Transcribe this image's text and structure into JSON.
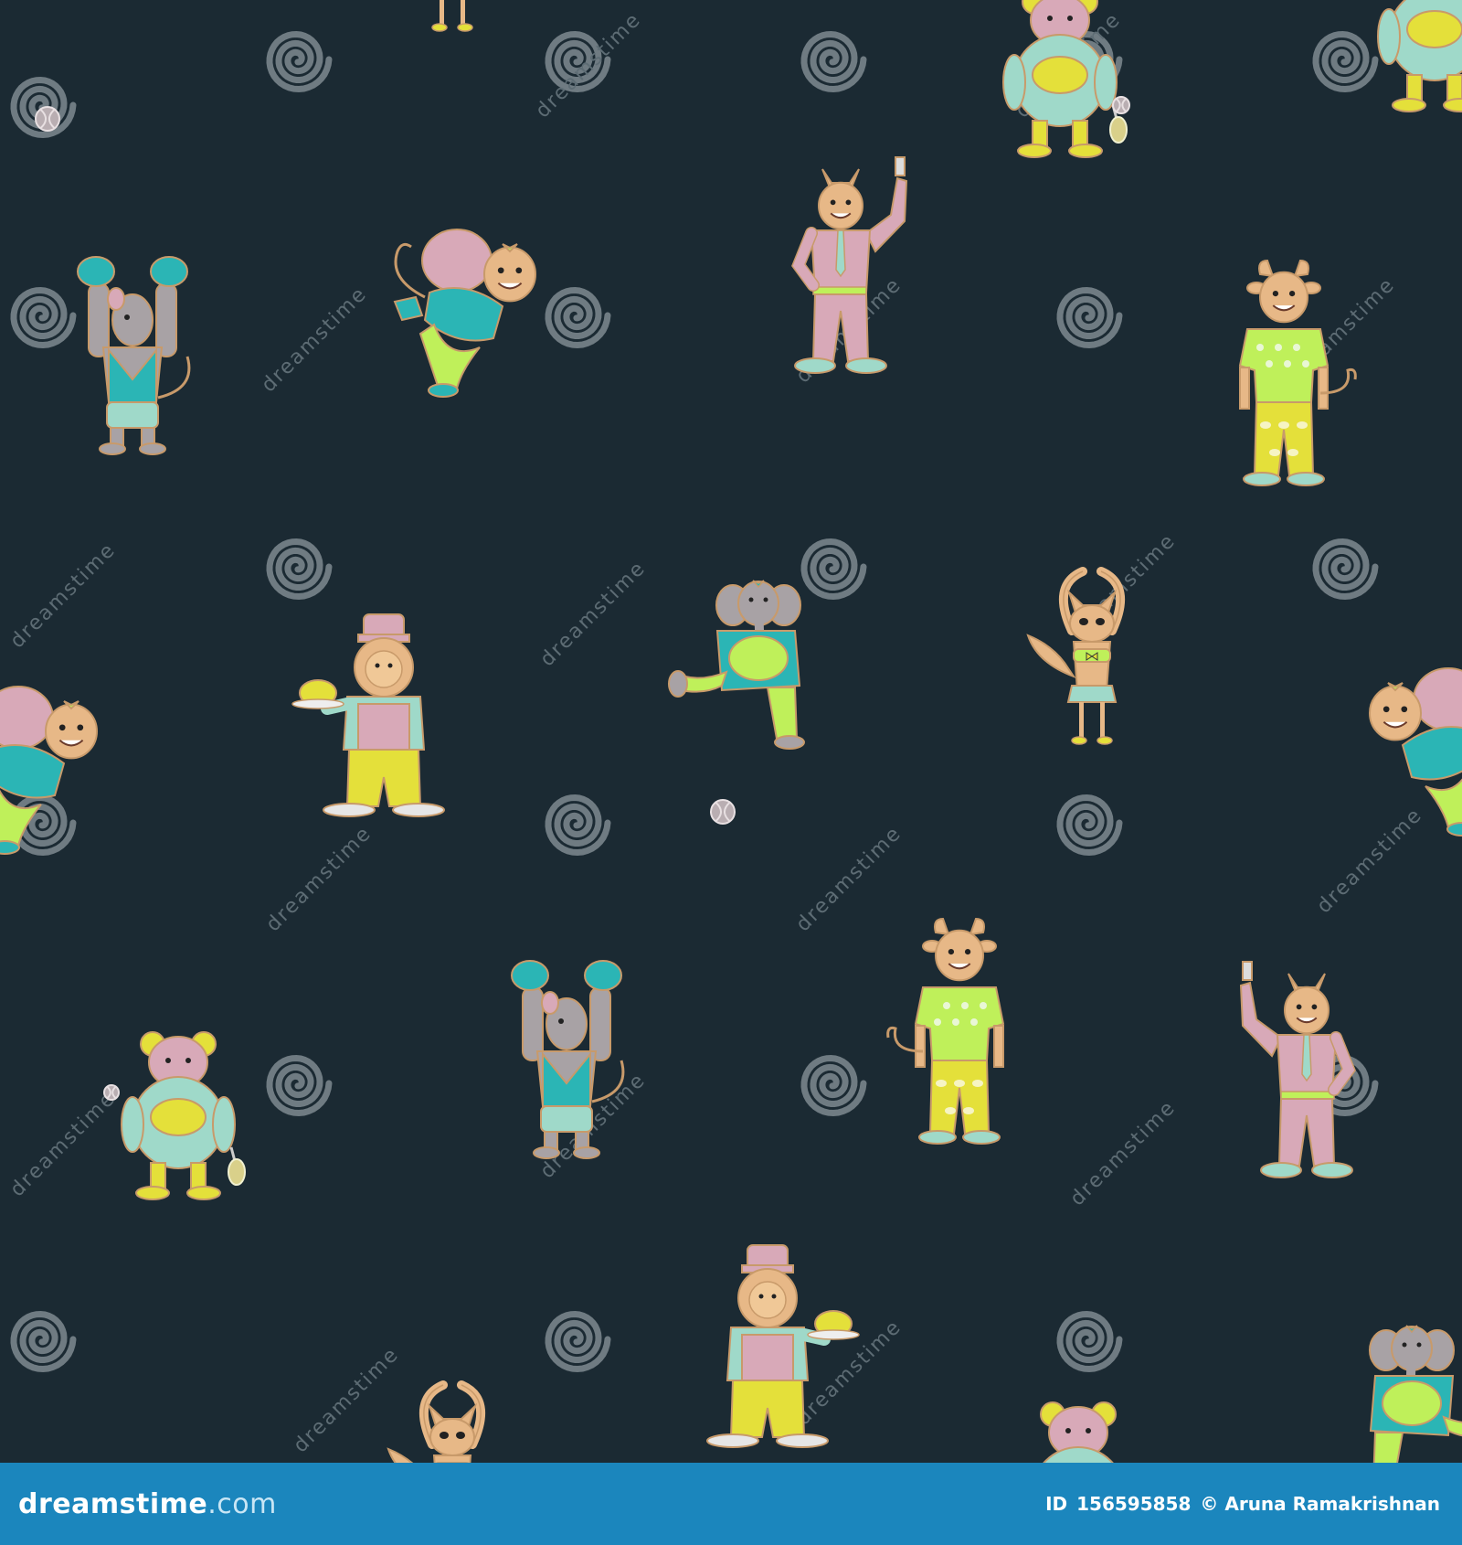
{
  "footer": {
    "brand_main": "dreamstime",
    "brand_suffix": ".com",
    "id_label": "ID",
    "id_value": "156595858",
    "copyright": "© Aruna Ramakrishnan"
  },
  "watermark": {
    "text": "dreamstime"
  },
  "colors": {
    "background": "#1b2a33",
    "footer_bar": "#1b86bd",
    "mint": "#9fd9c9",
    "teal": "#2bb5b5",
    "pink": "#d8a9b8",
    "yellow": "#e4e03a",
    "lime": "#bff05a",
    "tan": "#e7b887",
    "grey": "#a8a2a5"
  },
  "characters": [
    {
      "kind": "boxer-mouse",
      "label": "mouse-boxer"
    },
    {
      "kind": "monkey-sack",
      "label": "monkey-with-sack"
    },
    {
      "kind": "policeman-donkey",
      "label": "donkey-policeman"
    },
    {
      "kind": "cow-hawaiian",
      "label": "cow-in-hawaiian-shirt"
    },
    {
      "kind": "panda-tennis",
      "label": "panda-tennis-player"
    },
    {
      "kind": "chef-lion",
      "label": "lion-chef"
    },
    {
      "kind": "elephant-kick",
      "label": "elephant-footballer"
    },
    {
      "kind": "cat-dancer",
      "label": "cat-dancer"
    }
  ]
}
